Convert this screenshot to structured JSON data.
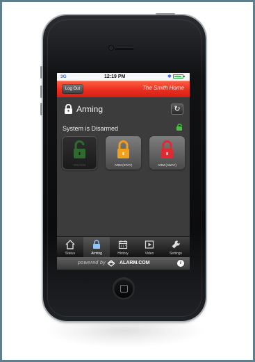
{
  "status_bar": {
    "carrier": "3G",
    "time": "12:19 PM",
    "battery_percent": 90
  },
  "header": {
    "logout_label": "Log Out",
    "home_name": "The Smith Home"
  },
  "main": {
    "section_title": "Arming",
    "system_status": "System is Disarmed",
    "buttons": [
      {
        "label": "DISARM",
        "color": "#2f6b2f"
      },
      {
        "label": "ARM (STAY)",
        "color": "#f2a01a"
      },
      {
        "label": "ARM (AWAY)",
        "color": "#dd2b34"
      }
    ]
  },
  "tabs": [
    {
      "label": "Status",
      "icon": "house-icon"
    },
    {
      "label": "Arming",
      "icon": "lock-icon"
    },
    {
      "label": "History",
      "icon": "calendar-icon"
    },
    {
      "label": "Video",
      "icon": "video-icon"
    },
    {
      "label": "Settings",
      "icon": "wrench-icon"
    }
  ],
  "footer": {
    "powered_text": "powered by",
    "brand": "ALARM.COM",
    "info_icon": "info-icon"
  },
  "colors": {
    "frame": "#5f7f8c",
    "header_red": "#e9331f",
    "screen_bg": "#3c3c3c"
  }
}
